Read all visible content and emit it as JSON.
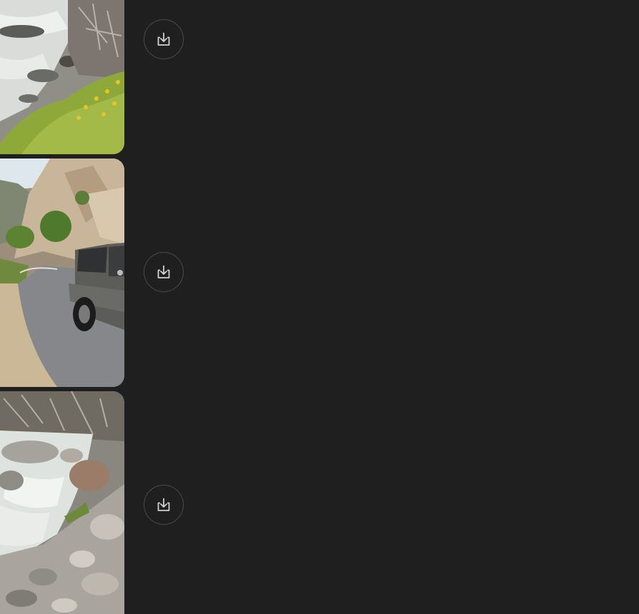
{
  "colors": {
    "background": "#1f1f1f",
    "button_border": "#4a4a4a",
    "icon_color": "#d0d0d0"
  },
  "media_items": [
    {
      "thumbnail": "river-rapids-with-yellow-wildflowers",
      "download_icon": "download-tray-arrow-icon"
    },
    {
      "thumbnail": "gray-pickup-truck-on-canyon-road",
      "download_icon": "download-tray-arrow-icon"
    },
    {
      "thumbnail": "river-rapids-with-boulders",
      "download_icon": "download-tray-arrow-icon"
    }
  ]
}
